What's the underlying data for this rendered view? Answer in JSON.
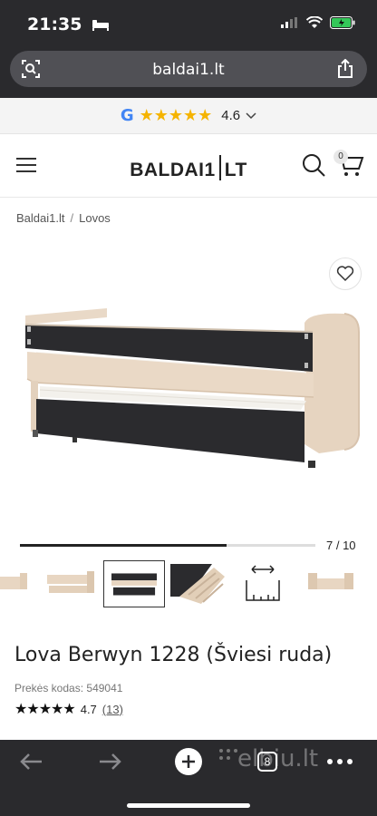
{
  "status": {
    "time": "21:35"
  },
  "browser": {
    "url": "baldai1.lt"
  },
  "rating_strip": {
    "google_letter": "G",
    "stars": "★★★★★",
    "value": "4.6"
  },
  "header": {
    "logo_left": "BALDAI1",
    "logo_right": "LT",
    "cart_count": "0"
  },
  "breadcrumb": {
    "items": [
      "Baldai1.lt",
      "Lovos"
    ],
    "separator": "/"
  },
  "gallery": {
    "counter": "7 / 10",
    "progress_fraction": 0.7
  },
  "product": {
    "title": "Lova Berwyn 1228 (Šviesi ruda)",
    "sku_label": "Prekės kodas:",
    "sku_value": "549041",
    "rating_stars": "★★★★★",
    "rating_value": "4.7",
    "review_count": "(13)"
  },
  "bottom_bar": {
    "tab_count": "8",
    "watermark": "elbiu.lt"
  },
  "colors": {
    "chrome_dark": "#2a2a2d",
    "star_gold": "#f5b400",
    "bed_beige": "#e7d6c3",
    "panel_dark": "#2b2b2e"
  }
}
